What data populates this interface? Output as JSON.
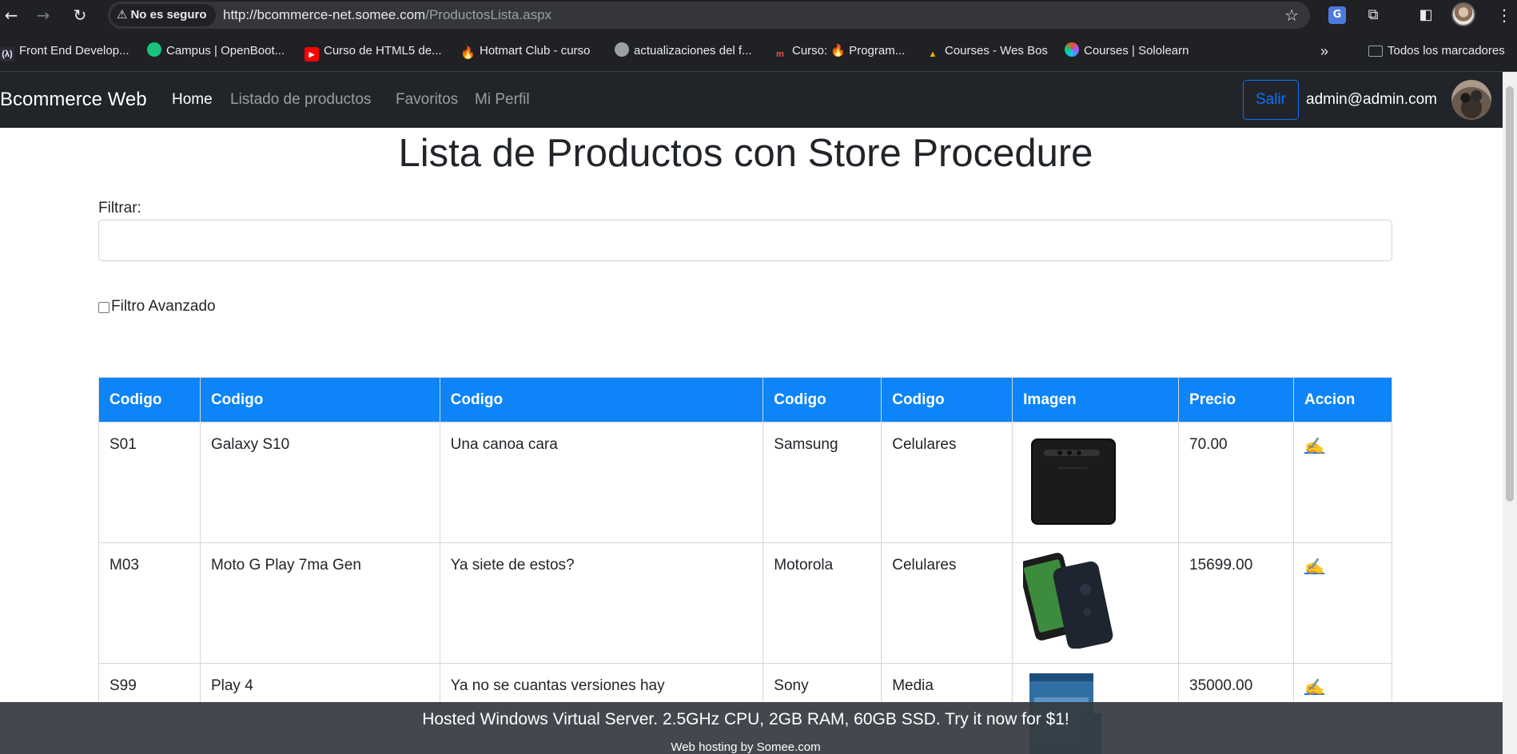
{
  "browser": {
    "security_label": "No es seguro",
    "url_host": "http://bcommerce-net.somee.com",
    "url_path": "/ProductosLista.aspx"
  },
  "bookmarks": [
    {
      "label": "Front End Develop...",
      "icon": "fcc-icon"
    },
    {
      "label": "Campus | OpenBoot...",
      "icon": "openbootcamp-icon"
    },
    {
      "label": "Curso de HTML5 de...",
      "icon": "youtube-icon"
    },
    {
      "label": "Hotmart Club - curso",
      "icon": "hotmart-icon"
    },
    {
      "label": "actualizaciones del f...",
      "icon": "globe-icon"
    },
    {
      "label": "Curso: 🔥 Program...",
      "icon": "udemy-icon"
    },
    {
      "label": "Courses - Wes Bos",
      "icon": "wesbos-icon"
    },
    {
      "label": "Courses | Sololearn",
      "icon": "sololearn-icon"
    }
  ],
  "bookmarks_all": "Todos los marcadores",
  "navbar": {
    "brand": "Bcommerce Web",
    "links": [
      "Home",
      "Listado de productos",
      "Favoritos",
      "Mi Perfil"
    ],
    "logout": "Salir",
    "user_email": "admin@admin.com"
  },
  "main": {
    "title": "Lista de Productos con Store Procedure",
    "filter_label": "Filtrar:",
    "advanced_label": "Filtro Avanzado",
    "columns": [
      "Codigo",
      "Codigo",
      "Codigo",
      "Codigo",
      "Codigo",
      "Imagen",
      "Precio",
      "Accion"
    ],
    "rows": [
      {
        "code": "S01",
        "name": "Galaxy S10",
        "description": "Una canoa cara",
        "brand": "Samsung",
        "category": "Celulares",
        "image": "samsung-phone-image",
        "price": "70.00",
        "action": "✍️"
      },
      {
        "code": "M03",
        "name": "Moto G Play 7ma Gen",
        "description": "Ya siete de estos?",
        "brand": "Motorola",
        "category": "Celulares",
        "image": "motorola-phone-image",
        "price": "15699.00",
        "action": "✍️"
      },
      {
        "code": "S99",
        "name": "Play 4",
        "description": "Ya no se cuantas versiones hay",
        "brand": "Sony",
        "category": "Media",
        "image": "ps4-box-image",
        "price": "35000.00",
        "action": "✍️"
      }
    ]
  },
  "footer": {
    "main": "Hosted Windows Virtual Server. 2.5GHz CPU, 2GB RAM, 60GB SSD. Try it now for $1!",
    "sub": "Web hosting by Somee.com"
  }
}
